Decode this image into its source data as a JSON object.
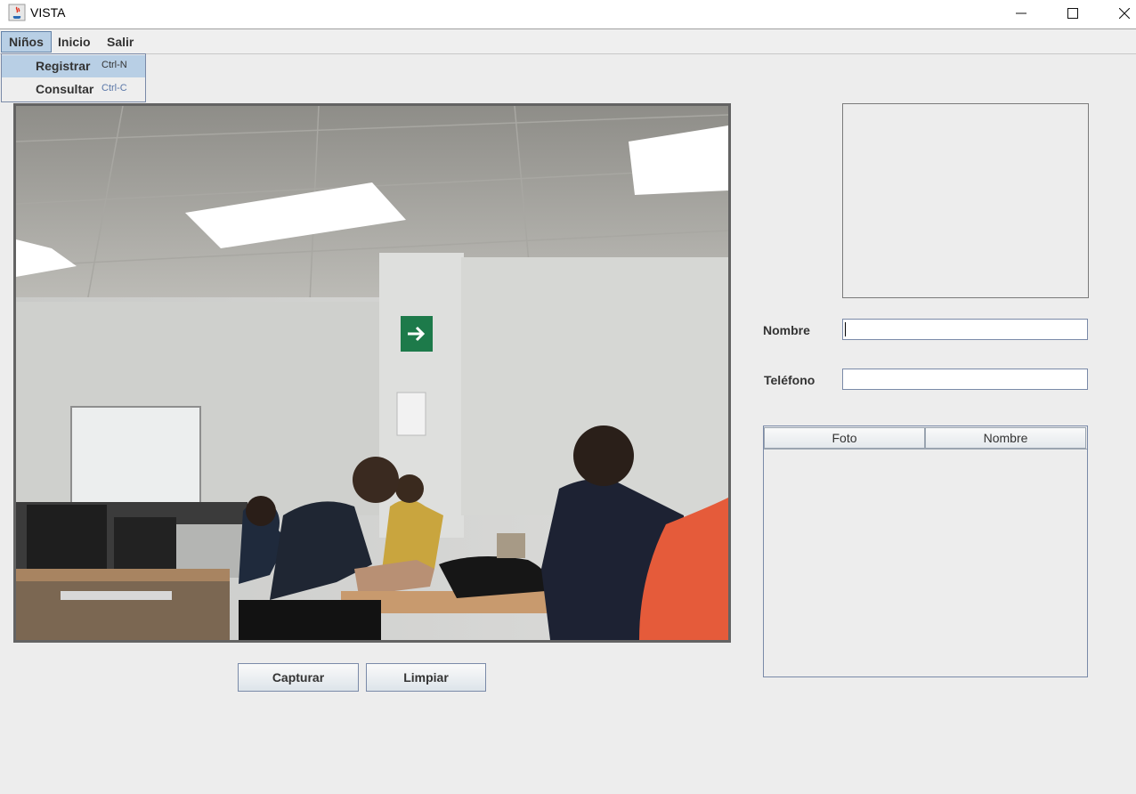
{
  "window": {
    "title": "VISTA"
  },
  "menubar": {
    "items": [
      {
        "label": "Niños"
      },
      {
        "label": "Inicio"
      },
      {
        "label": "Salir"
      }
    ]
  },
  "dropdown": {
    "items": [
      {
        "label": "Registrar",
        "shortcut": "Ctrl-N"
      },
      {
        "label": "Consultar",
        "shortcut": "Ctrl-C"
      }
    ]
  },
  "buttons": {
    "capture": "Capturar",
    "clear": "Limpiar"
  },
  "form": {
    "name_label": "Nombre",
    "name_value": "",
    "phone_label": "Teléfono",
    "phone_value": ""
  },
  "table": {
    "columns": [
      "Foto",
      "Nombre"
    ],
    "rows": []
  },
  "colors": {
    "menu_highlight": "#b8cfe5",
    "border_accent": "#7a8aa8"
  }
}
